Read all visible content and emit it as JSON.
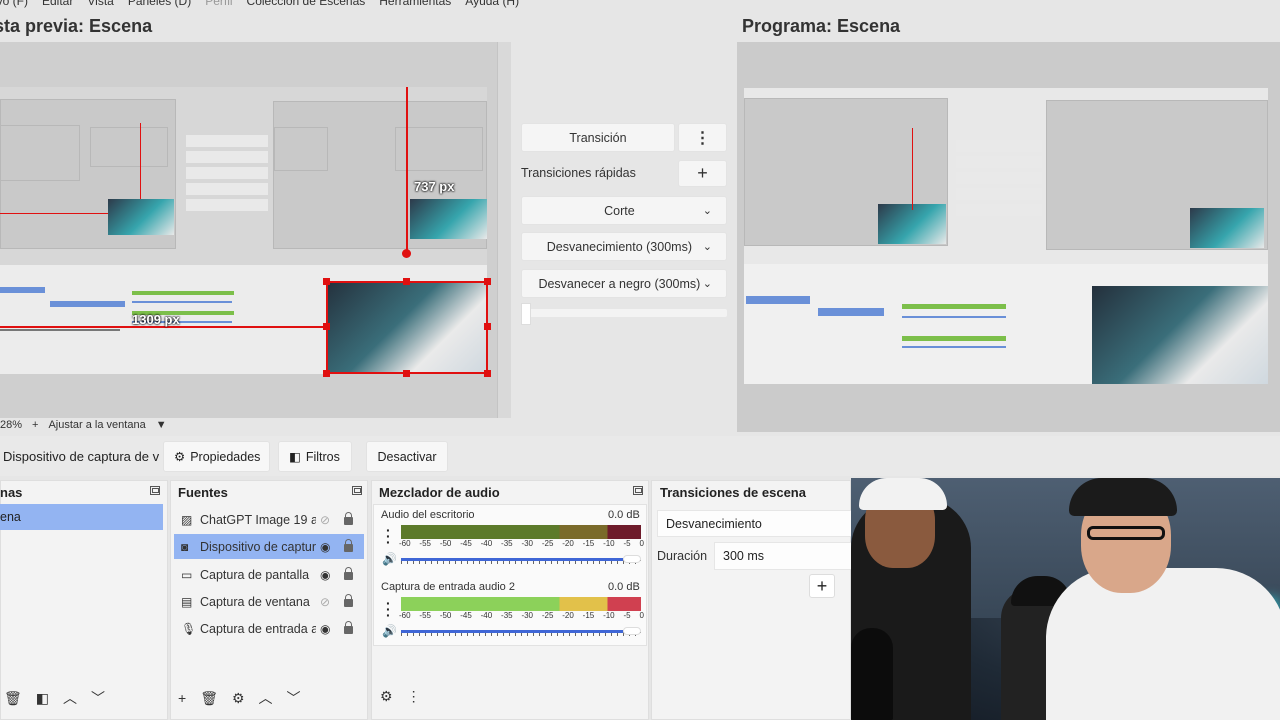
{
  "menu": [
    "ivo (F)",
    "Editar",
    "Vista",
    "Paneles (D)",
    "Perfil",
    "Colección de Escenas",
    "Herramientas",
    "Ayuda (H)"
  ],
  "preview": {
    "title": "sta previa: Escena",
    "width_label": "737 px",
    "height_label": "1309 px",
    "zoom": "28%",
    "fit_label": "Ajustar a la ventana"
  },
  "program": {
    "title": "Programa: Escena"
  },
  "transitions_panel": {
    "transition_button": "Transición",
    "quick_label": "Transiciones rápidas",
    "items": [
      "Corte",
      "Desvanecimiento (300ms)",
      "Desvanecer a negro (300ms)"
    ]
  },
  "source_toolbar": {
    "source_name": "Dispositivo de captura de v",
    "properties": "Propiedades",
    "filters": "Filtros",
    "deactivate": "Desactivar"
  },
  "scenes": {
    "title": "nas",
    "items": [
      "ena"
    ]
  },
  "sources": {
    "title": "Fuentes",
    "items": [
      {
        "label": "ChatGPT Image 19 ag",
        "icon": "image-icon",
        "visible": false
      },
      {
        "label": "Dispositivo de captur",
        "icon": "camera-icon",
        "visible": true,
        "selected": true
      },
      {
        "label": "Captura de pantalla",
        "icon": "monitor-icon",
        "visible": true
      },
      {
        "label": "Captura de ventana",
        "icon": "window-icon",
        "visible": false
      },
      {
        "label": "Captura de entrada a",
        "icon": "mic-icon",
        "visible": true
      }
    ]
  },
  "mixer": {
    "title": "Mezclador de audio",
    "scale": [
      "-60",
      "-55",
      "-50",
      "-45",
      "-40",
      "-35",
      "-30",
      "-25",
      "-20",
      "-15",
      "-10",
      "-5",
      "0"
    ],
    "channels": [
      {
        "label": "Audio del escritorio",
        "db": "0.0 dB",
        "level": 0
      },
      {
        "label": "Captura de entrada audio 2",
        "db": "0.0 dB",
        "level": 0.5
      }
    ]
  },
  "scene_transitions": {
    "title": "Transiciones de escena",
    "selected": "Desvanecimiento",
    "duration_label": "Duración",
    "duration_value": "300 ms"
  },
  "colors": {
    "accent": "#93b4f2",
    "guide": "#e01010",
    "volume": "#3f66d6"
  }
}
